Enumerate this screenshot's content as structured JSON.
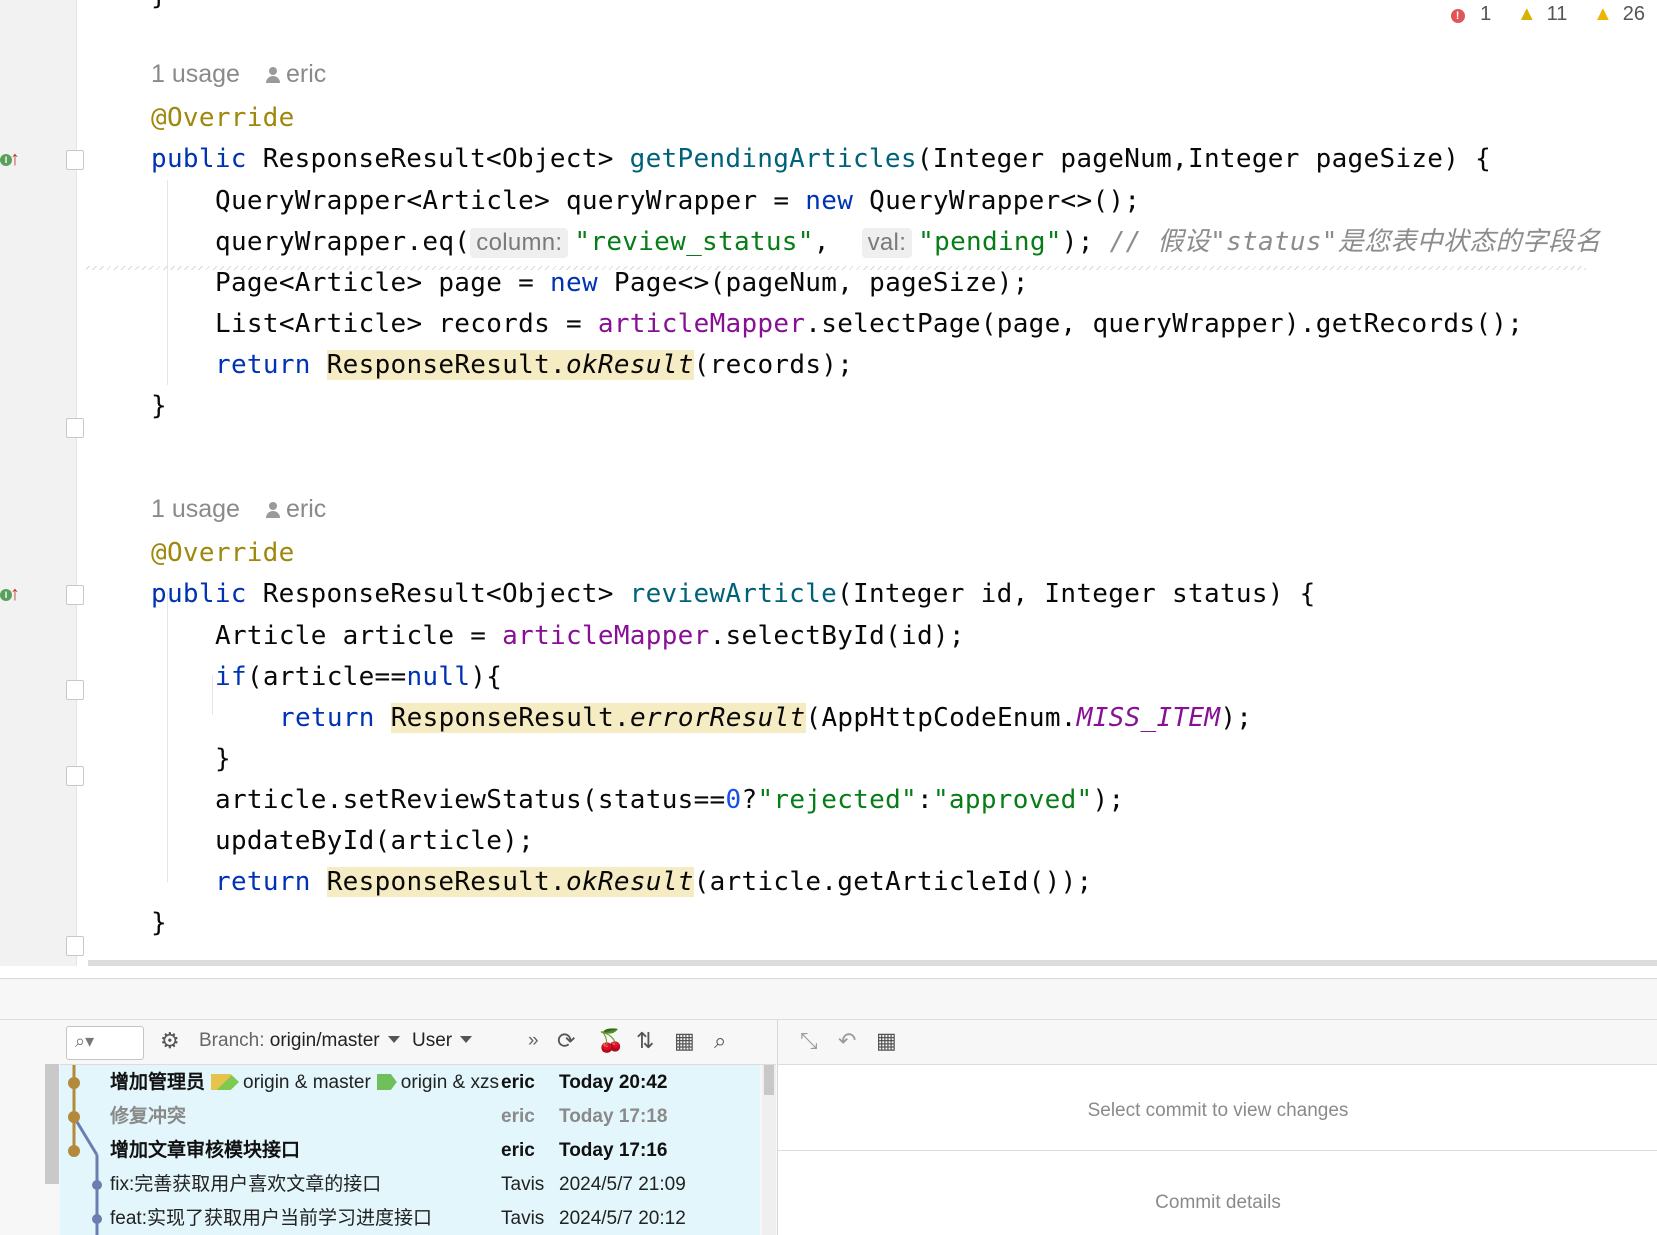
{
  "inspections": {
    "errors": "1",
    "weak_warnings": "11",
    "warnings": "26"
  },
  "code_top_brace": "}",
  "method1": {
    "lens_usage": "1 usage",
    "lens_author": "eric",
    "annotation": "@Override",
    "sig_public": "public",
    "sig_type": " ResponseResult<Object> ",
    "sig_name": "getPendingArticles",
    "sig_params": "(Integer pageNum,Integer pageSize) {",
    "l1_a": "QueryWrapper<Article> queryWrapper = ",
    "l1_new": "new",
    "l1_b": " QueryWrapper<>();",
    "l2_a": "queryWrapper.eq(",
    "l2_hint1": "column:",
    "l2_str1": "\"review_status\"",
    "l2_comma": ", ",
    "l2_hint2": "val:",
    "l2_str2": "\"pending\"",
    "l2_end": "); ",
    "l2_comment": "// 假设\"status\"是您表中状态的字段名",
    "l3_a": "Page<Article> page = ",
    "l3_new": "new",
    "l3_b": " Page<>(pageNum, pageSize);",
    "l4_a": "List<Article> records = ",
    "l4_field": "articleMapper",
    "l4_b": ".selectPage(page, queryWrapper).getRecords();",
    "l5_return": "return",
    "l5_cls": "ResponseResult.",
    "l5_method": "okResult",
    "l5_b": "(records);",
    "close": "}"
  },
  "method2": {
    "lens_usage": "1 usage",
    "lens_author": "eric",
    "annotation": "@Override",
    "sig_public": "public",
    "sig_type": " ResponseResult<Object> ",
    "sig_name": "reviewArticle",
    "sig_params": "(Integer id, Integer status) {",
    "l1_a": "Article article = ",
    "l1_field": "articleMapper",
    "l1_b": ".selectById(id);",
    "l2_if": "if",
    "l2_a": "(article==",
    "l2_null": "null",
    "l2_b": "){",
    "l3_return": "return",
    "l3_cls": "ResponseResult.",
    "l3_method": "errorResult",
    "l3_b": "(AppHttpCodeEnum.",
    "l3_const": "MISS_ITEM",
    "l3_c": ");",
    "l4_close": "}",
    "l5_a": "article.setReviewStatus(status==",
    "l5_num": "0",
    "l5_b": "?",
    "l5_s1": "\"rejected\"",
    "l5_c": ":",
    "l5_s2": "\"approved\"",
    "l5_d": ");",
    "l6": "updateById(article);",
    "l7_return": "return",
    "l7_cls": "ResponseResult.",
    "l7_method": "okResult",
    "l7_b": "(article.getArticleId());",
    "close": "}"
  },
  "vcs_toolbar": {
    "branch_label": "Branch:",
    "branch_value": "origin/master",
    "user_label": "User",
    "more": "»"
  },
  "log_rows": [
    {
      "message": "增加管理员",
      "tags": [
        "origin & master",
        "origin & xzs"
      ],
      "author": "eric",
      "date": "Today 20:42",
      "style": "bold"
    },
    {
      "message": "修复冲突",
      "tags": [],
      "author": "eric",
      "date": "Today 17:18",
      "style": "grey"
    },
    {
      "message": "增加文章审核模块接口",
      "tags": [],
      "author": "eric",
      "date": "Today 17:16",
      "style": "bold"
    },
    {
      "message": "fix:完善获取用户喜欢文章的接口",
      "tags": [],
      "author": "Tavis",
      "date": "2024/5/7 21:09",
      "style": "plain"
    },
    {
      "message": "feat:实现了获取用户当前学习进度接口",
      "tags": [],
      "author": "Tavis",
      "date": "2024/5/7 20:12",
      "style": "plain"
    }
  ],
  "right_pane": {
    "empty_message": "Select commit to view changes",
    "details_label": "Commit details"
  },
  "colors": {
    "log_bg": "#e3f6fb",
    "keyword": "#0033b3",
    "string": "#067d17",
    "highlight": "#f5ecc4"
  }
}
